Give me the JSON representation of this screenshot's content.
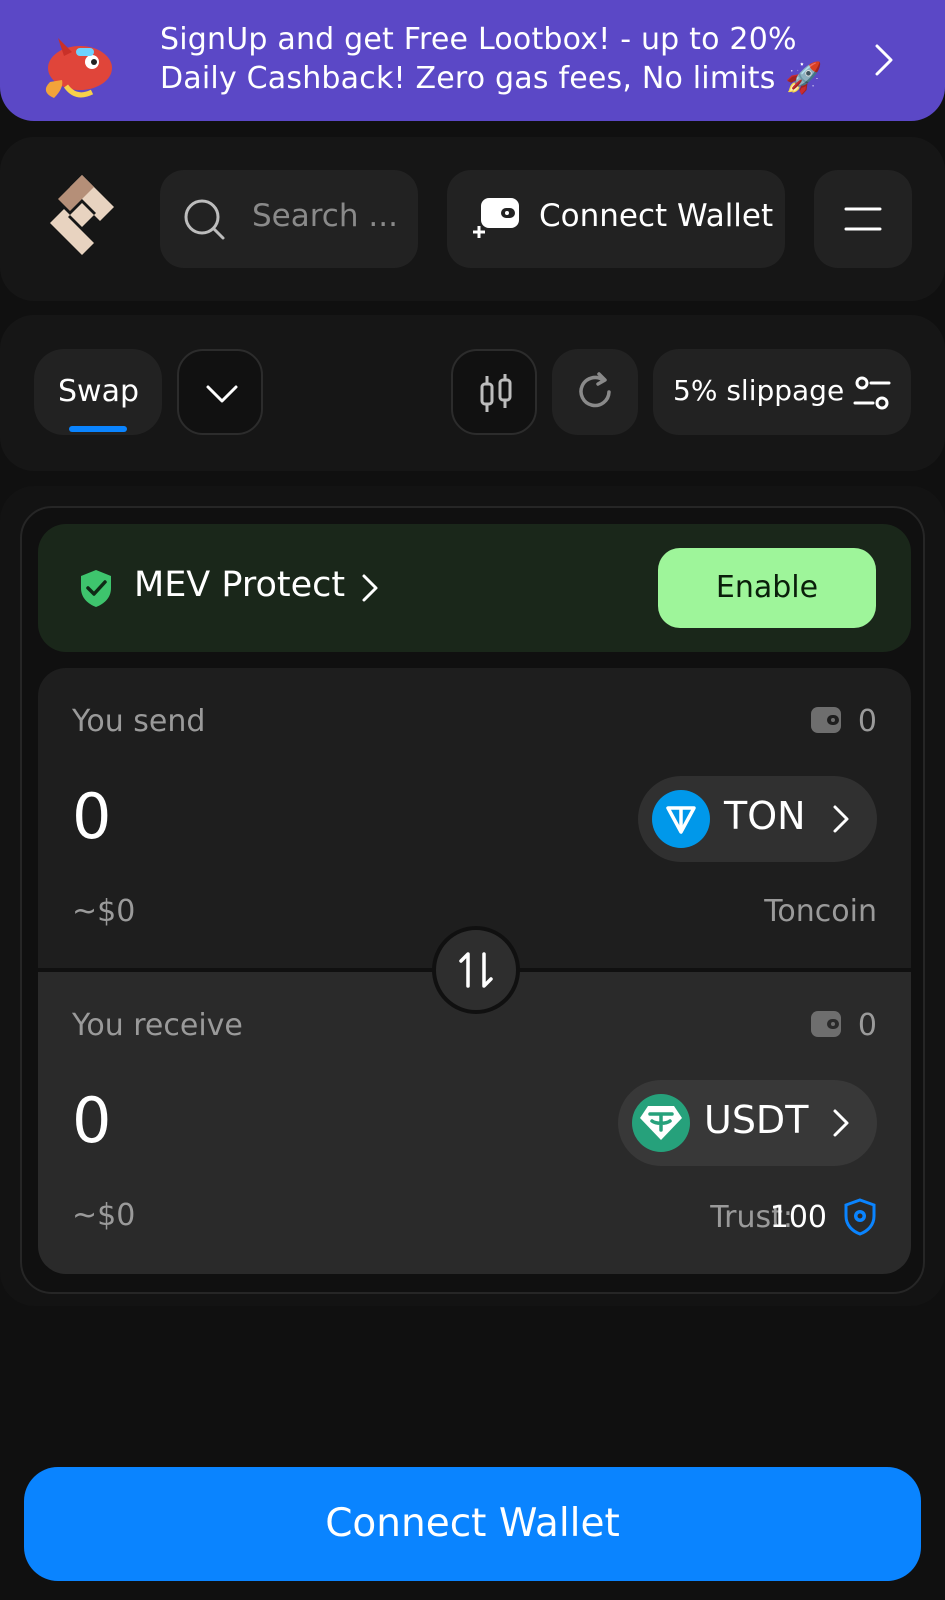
{
  "banner": {
    "line1": "SignUp and get Free Lootbox! - up to 20%",
    "line2": "Daily Cashback! Zero gas fees, No limits 🚀"
  },
  "header": {
    "search_placeholder": "Search ...",
    "connect_wallet_label": "Connect Wallet"
  },
  "toolbar": {
    "swap_tab_label": "Swap",
    "slippage_label": "5% slippage"
  },
  "mev": {
    "label": "MEV Protect",
    "enable_label": "Enable"
  },
  "send": {
    "label": "You send",
    "balance": "0",
    "amount": "0",
    "usd_value": "~$0",
    "token_symbol": "TON",
    "token_name": "Toncoin"
  },
  "receive": {
    "label": "You receive",
    "balance": "0",
    "amount": "0",
    "usd_value": "~$0",
    "token_symbol": "USDT",
    "trust_label": "Trust:",
    "trust_value": "100"
  },
  "footer": {
    "connect_wallet_label": "Connect Wallet"
  },
  "colors": {
    "accent": "#0a84ff",
    "banner": "#5b48c6",
    "enable": "#9ef59a",
    "ton": "#0098ea",
    "usdt": "#26a17b"
  },
  "icons": {
    "banner": "mascot-icon",
    "search": "search-icon",
    "wallet": "wallet-add-icon",
    "menu": "hamburger-menu-icon",
    "chart": "candlestick-chart-icon",
    "refresh": "refresh-icon",
    "settings": "sliders-icon",
    "mev": "shield-check-icon",
    "swap_direction": "swap-arrows-icon",
    "trust": "trust-shield-icon"
  }
}
